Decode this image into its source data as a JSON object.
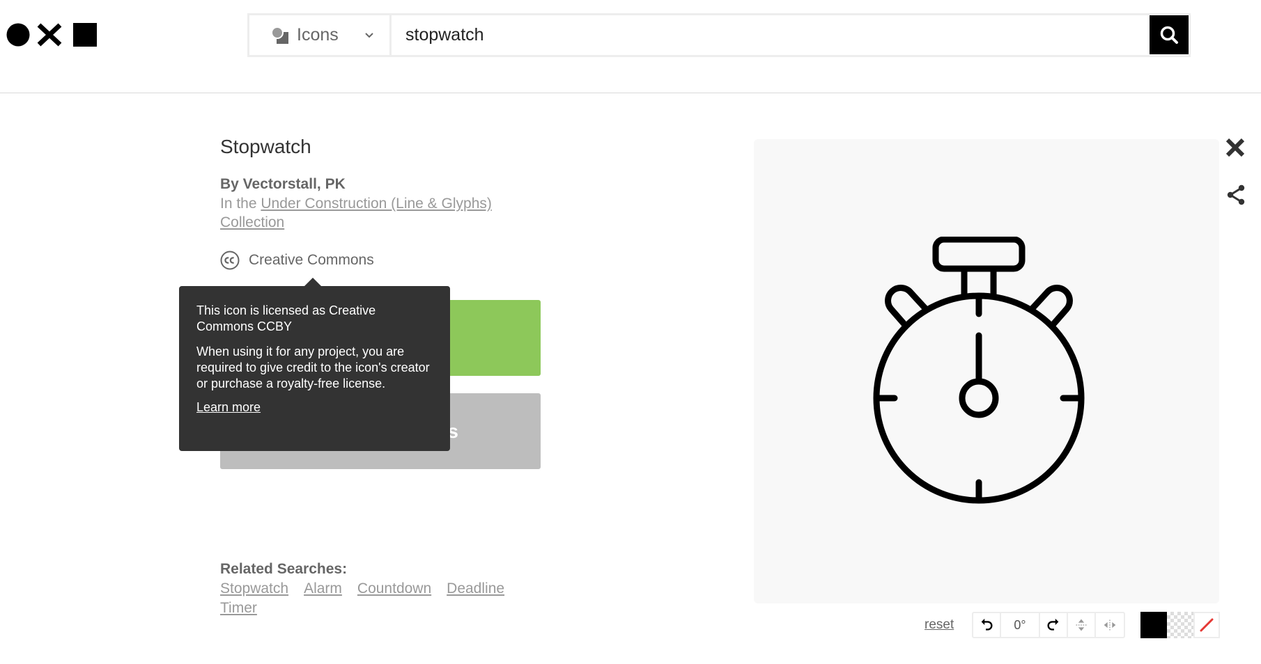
{
  "header": {
    "search_type_label": "Icons",
    "search_value": "stopwatch",
    "type_icon": "shapes-icon",
    "search_icon": "search-icon"
  },
  "icon": {
    "title": "Stopwatch",
    "author": "By Vectorstall, PK",
    "collection_prefix": "In the ",
    "collection_link": "Under Construction (Line & Glyphs) Collection",
    "license_label": "Creative Commons"
  },
  "buttons": {
    "secondary_visible_text": "s"
  },
  "tooltip": {
    "title": "This icon is licensed as Creative Commons CCBY",
    "body": "When using it for any project, you are required to give credit to the icon's creator or purchase a royalty-free license.",
    "link": "Learn more"
  },
  "related": {
    "label": "Related Searches:",
    "items": [
      "Stopwatch",
      "Alarm",
      "Countdown",
      "Deadline",
      "Timer"
    ]
  },
  "editor": {
    "reset_label": "reset",
    "angle": "0°"
  },
  "colors": {
    "accent_green": "#8dc85a",
    "tooltip_bg": "#333333",
    "secondary_button": "#bdbdbd",
    "none_swatch_slash": "#e53935"
  }
}
